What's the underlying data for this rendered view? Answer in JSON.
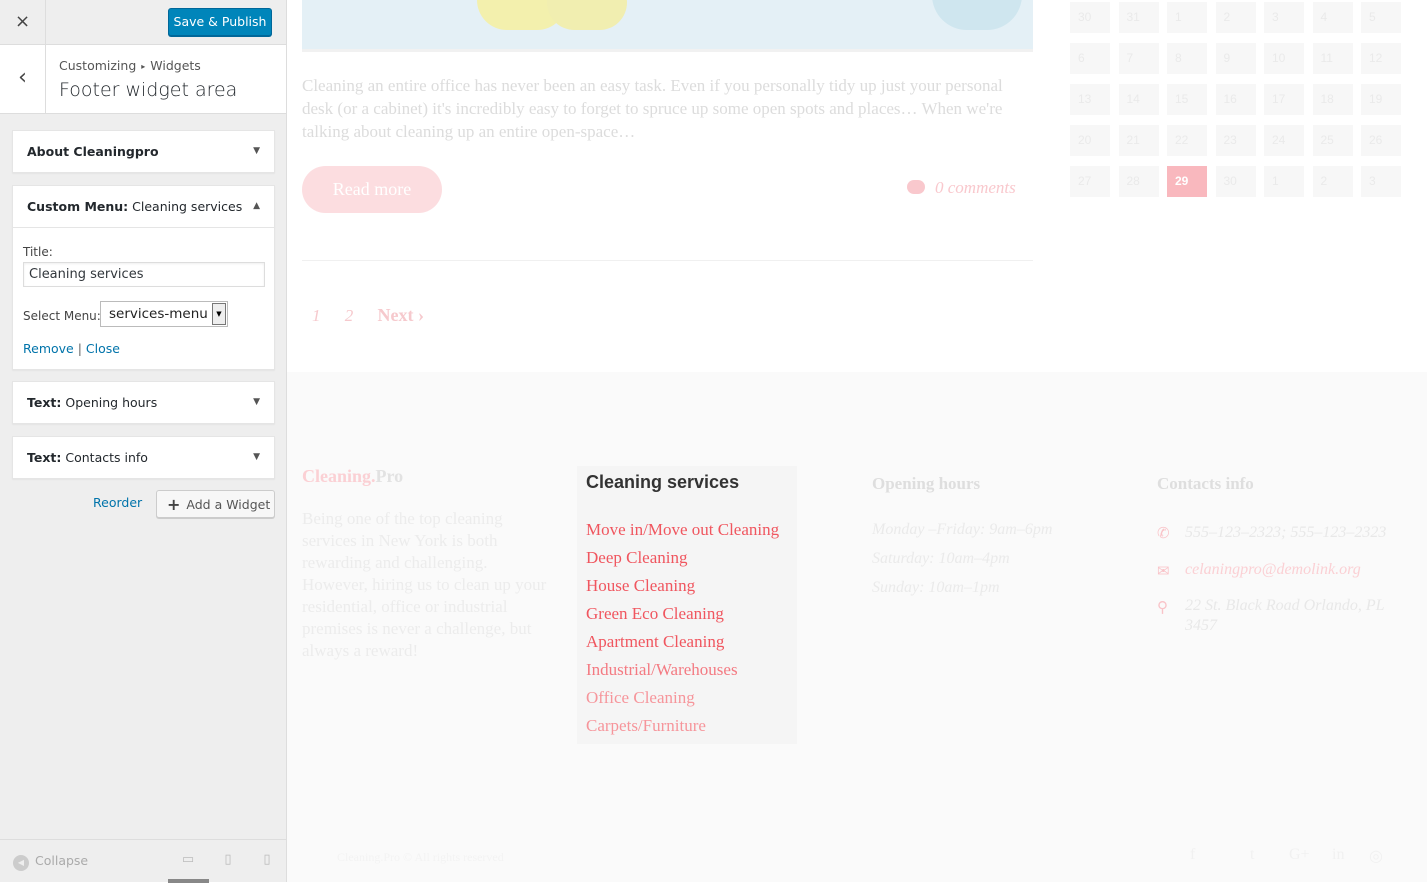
{
  "topbar": {
    "close_icon": "×",
    "publish_label": "Save & Publish"
  },
  "section": {
    "back_icon": "‹",
    "breadcrumb_parent": "Customizing",
    "breadcrumb_sep": "▸",
    "breadcrumb_child": "Widgets",
    "title": "Footer widget area"
  },
  "widgets": [
    {
      "kind": "About Cleaningpro",
      "name": "",
      "arrow": "▼"
    },
    {
      "kind": "Custom Menu:",
      "name": "Cleaning services",
      "arrow": "▲"
    },
    {
      "kind": "Text:",
      "name": "Opening hours",
      "arrow": "▼"
    },
    {
      "kind": "Text:",
      "name": "Contacts info",
      "arrow": "▼"
    }
  ],
  "menu_form": {
    "title_label": "Title:",
    "title_value": "Cleaning services",
    "select_label": "Select Menu:",
    "select_value": "services-menu",
    "remove_label": "Remove",
    "separator": "|",
    "close_label": "Close"
  },
  "actions": {
    "reorder_label": "Reorder",
    "add_icon": "+",
    "add_label": "Add a Widget"
  },
  "footer_bar": {
    "collapse_label": "Collapse",
    "collapse_icon": "◀",
    "desktop_icon": "▭",
    "tablet_icon": "▯",
    "mobile_icon": "▯"
  },
  "preview": {
    "excerpt": "Cleaning an entire office has never been an easy task. Even if you personally tidy up just your personal desk (or a cabinet) it's incredibly easy to forget to spruce up some open spots and places… When we're talking about cleaning up an entire open-space…",
    "read_more": "Read more",
    "comments": "0 comments",
    "pages": [
      "1",
      "2"
    ],
    "next_label": "Next",
    "next_icon": "›",
    "calendar": {
      "rows": [
        [
          "30",
          "31",
          "1",
          "2",
          "3",
          "4",
          "5"
        ],
        [
          "6",
          "7",
          "8",
          "9",
          "10",
          "11",
          "12"
        ],
        [
          "13",
          "14",
          "15",
          "16",
          "17",
          "18",
          "19"
        ],
        [
          "20",
          "21",
          "22",
          "23",
          "24",
          "25",
          "26"
        ],
        [
          "27",
          "28",
          "29",
          "30",
          "1",
          "2",
          "3"
        ]
      ],
      "today": "29"
    },
    "logo_part1": "Cleaning.",
    "logo_part2": "Pro",
    "about": "Being one of the top cleaning services in New York is both rewarding and challenging. However, hiring us to clean up your residential, office or industrial premises is never a challenge, but always a reward!",
    "menu_widget": {
      "title": "Cleaning services",
      "links": [
        "Move in/Move out Cleaning",
        "Deep Cleaning",
        "House Cleaning",
        "Green Eco Cleaning",
        "Apartment Cleaning",
        "Industrial/Warehouses",
        "Office Cleaning",
        "Carpets/Furniture"
      ]
    },
    "hours": {
      "title": "Opening hours",
      "lines": [
        "Monday –Friday: 9am–6pm",
        "Saturday: 10am–4pm",
        "Sunday: 10am–1pm"
      ]
    },
    "contacts": {
      "title": "Contacts info",
      "phone": "555–123–2323; 555–123–2323",
      "email": "celaningpro@demolink.org",
      "address": "22 St. Black Road Orlando, PL 3457",
      "phone_icon": "✆",
      "email_icon": "✉",
      "pin_icon": "⚲"
    },
    "copyright": "Cleaning.Pro © All rights reserved",
    "social_icons": [
      "f",
      "t",
      "G+",
      "in",
      "◎"
    ]
  },
  "colors": {
    "primary_button": "#0085ba",
    "link": "#0073aa",
    "menu_link": "#f0565f",
    "faded_pink": "#f9c8cd"
  }
}
